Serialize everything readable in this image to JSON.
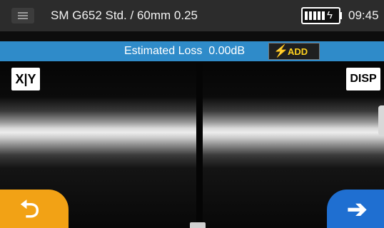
{
  "status_bar": {
    "title": "SM G652 Std. / 60mm 0.25",
    "time": "09:45",
    "battery_icon": "battery-icon",
    "charging_icon": "lightning-icon"
  },
  "loss_bar": {
    "label": "Estimated Loss",
    "value": "0.00dB",
    "add_label": "ADD",
    "add_icon": "lightning-icon"
  },
  "view": {
    "xy_label": "X|Y",
    "disp_label": "DISP"
  },
  "nav": {
    "back_icon": "back-arrow-icon",
    "next_icon": "right-arrow-icon"
  },
  "colors": {
    "status_bar_bg": "#2c2c2c",
    "loss_bar_bg": "#2f8bc9",
    "add_text": "#ffd21f",
    "back_button": "#f2a215",
    "next_button": "#1f6fd1"
  }
}
